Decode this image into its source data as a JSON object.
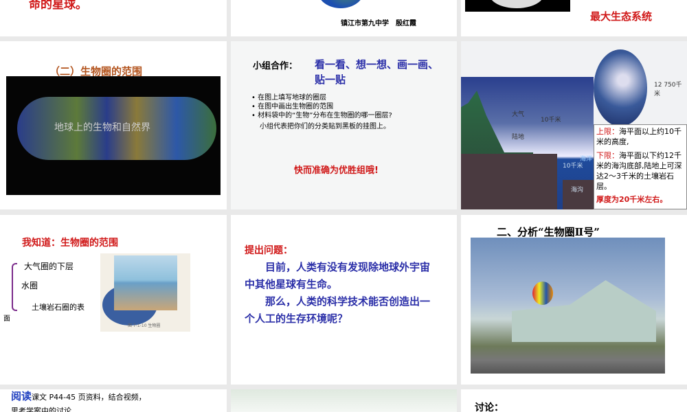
{
  "slides": [
    {
      "text": "命的星球。"
    },
    {
      "author": "镇江市第九中学　殷红霞"
    },
    {
      "caption": "最大生态系统"
    },
    {
      "title": "（二）生物圈的范围",
      "video_text": "地球上的生物和自然界"
    },
    {
      "heading_black": "小组合作：",
      "heading_blue": "看一看、想一想、画一画、贴一贴",
      "bullets": [
        "在图上填写地球的圈层",
        "在图中画出生物圈的范围",
        "材料袋中的“生物”分布在生物圈的哪一圈层?"
      ],
      "note": "小组代表把你们的分类贴到黑板的挂图上。",
      "slogan": "快而准确为优胜组哦!"
    },
    {
      "labels": {
        "atmosphere": "大气",
        "land": "陆地",
        "ocean": "海洋",
        "trench": "海沟",
        "up10": "10千米",
        "down10": "10千米",
        "diameter": "12 750千米"
      },
      "upper_label": "上限：",
      "upper_text": "海平面以上约10千米的高度,",
      "lower_label": "下限：",
      "lower_text": "海平面以下约12千米的海沟底部,陆地上可深达2～3千米的土壤岩石层。",
      "thickness": "厚度为20千米左右。"
    },
    {
      "title": "我知道：生物圈的范围",
      "items": [
        "大气圈的下层",
        "水圈",
        "土壤岩石圈的表"
      ],
      "overflow": "面",
      "figure_caption": "图 7-1-10 生物圈"
    },
    {
      "label": "提出问题：",
      "p1": "目前，人类有没有发现除地球外宇宙中其他星球有生命。",
      "p2": "那么，人类的科学技术能否创造出一个人工的生存环境呢？"
    },
    {
      "title": "二、分析“生物圈Ⅱ号”"
    },
    {
      "read": "阅读",
      "text": "课文 P44-45 页资料，结合视频，",
      "text2": "思考学案中的讨论"
    },
    {},
    {
      "text": "讨论："
    }
  ]
}
